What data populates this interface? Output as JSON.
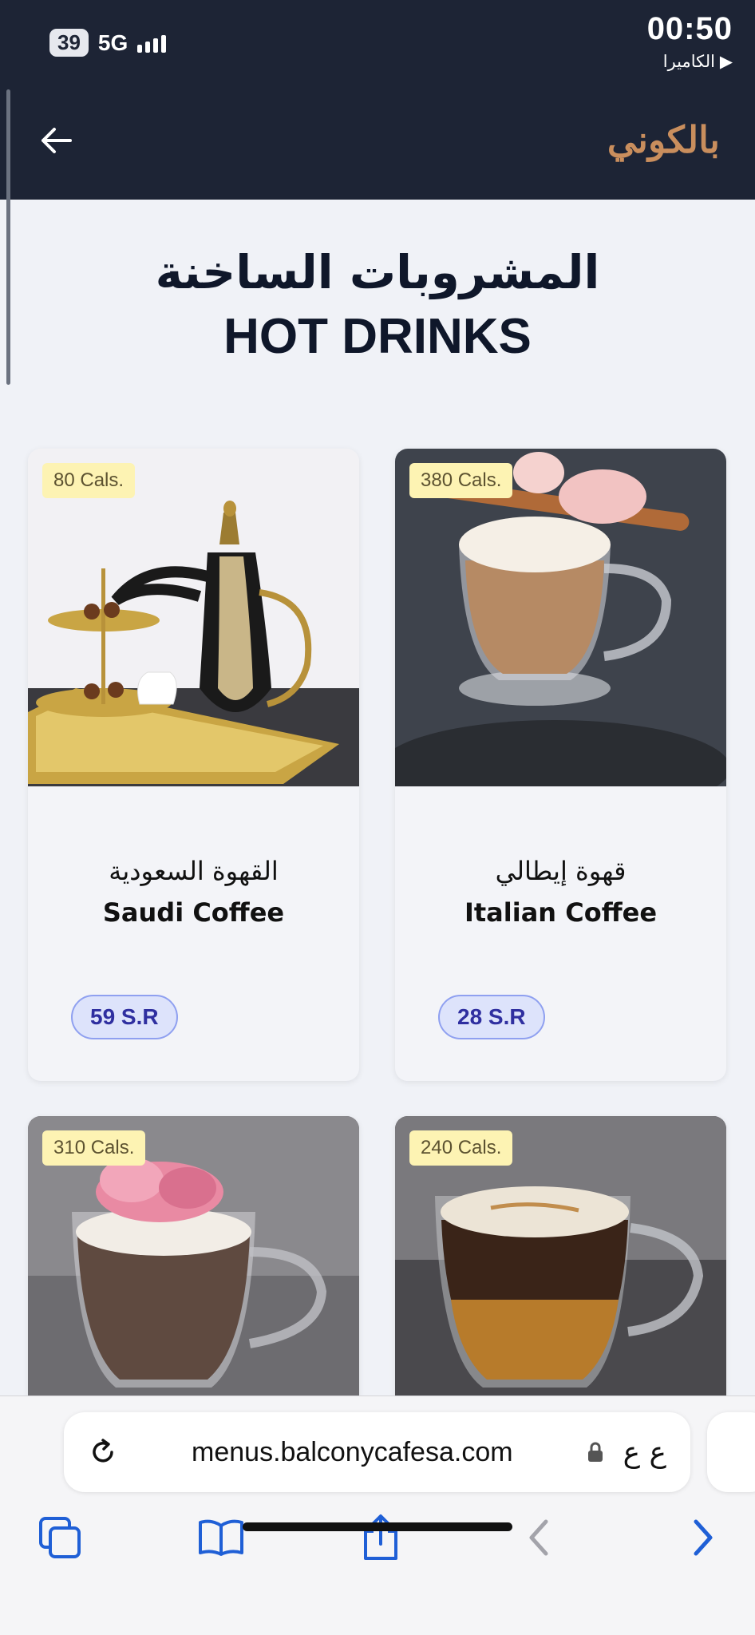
{
  "status": {
    "battery": "39",
    "network": "5G",
    "time": "00:50",
    "back_app": "الكاميرا"
  },
  "brand": {
    "logo_text": "بالكوني"
  },
  "page": {
    "title_ar": "المشروبات الساخنة",
    "title_en": "HOT DRINKS"
  },
  "items": [
    {
      "calories": "80 Cals.",
      "name_ar": "القهوة السعودية",
      "name_en": "Saudi Coffee",
      "price": "59 S.R"
    },
    {
      "calories": "380 Cals.",
      "name_ar": "قهوة إيطالي",
      "name_en": "Italian Coffee",
      "price": "28 S.R"
    },
    {
      "calories": "310 Cals."
    },
    {
      "calories": "240 Cals."
    }
  ],
  "browser": {
    "url": "menus.balconycafesa.com",
    "text_size_label": "ع ع"
  },
  "colors": {
    "header_bg": "#1d2435",
    "logo": "#c98e5d",
    "price_text": "#2f2fa0",
    "badge_bg": "#fdf3b3",
    "accent": "#1f5fd6"
  }
}
